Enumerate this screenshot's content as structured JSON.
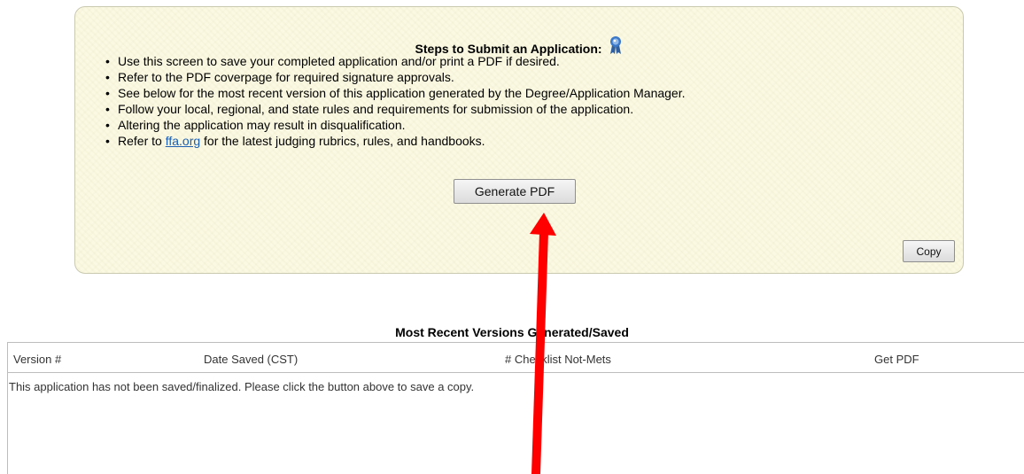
{
  "panel": {
    "title": "Steps to Submit an Application:",
    "steps": [
      {
        "text": "Use this screen to save your completed application and/or print a PDF if desired."
      },
      {
        "text": "Refer to the PDF coverpage for required signature approvals."
      },
      {
        "text": "See below for the most recent version of this application generated by the Degree/Application Manager."
      },
      {
        "text": "Follow your local, regional, and state rules and requirements for submission of the application."
      },
      {
        "text": "Altering the application may result in disqualification."
      },
      {
        "prefix": "Refer to ",
        "link": "ffa.org",
        "suffix": " for the latest judging rubrics, rules, and handbooks."
      }
    ],
    "generate_label": "Generate PDF",
    "copy_label": "Copy"
  },
  "versions": {
    "title": "Most Recent Versions Generated/Saved",
    "columns": [
      "Version #",
      "Date Saved (CST)",
      "# Checklist Not-Mets",
      "Get PDF"
    ],
    "empty_message": "This application has not been saved/finalized. Please click the button above to save a copy."
  },
  "colors": {
    "panel_bg": "#fbf9e2",
    "link": "#1a5fb4",
    "annotation_arrow": "#ff0000",
    "ribbon": "#3c78c8"
  },
  "icons": {
    "ribbon": "award-ribbon-icon"
  }
}
